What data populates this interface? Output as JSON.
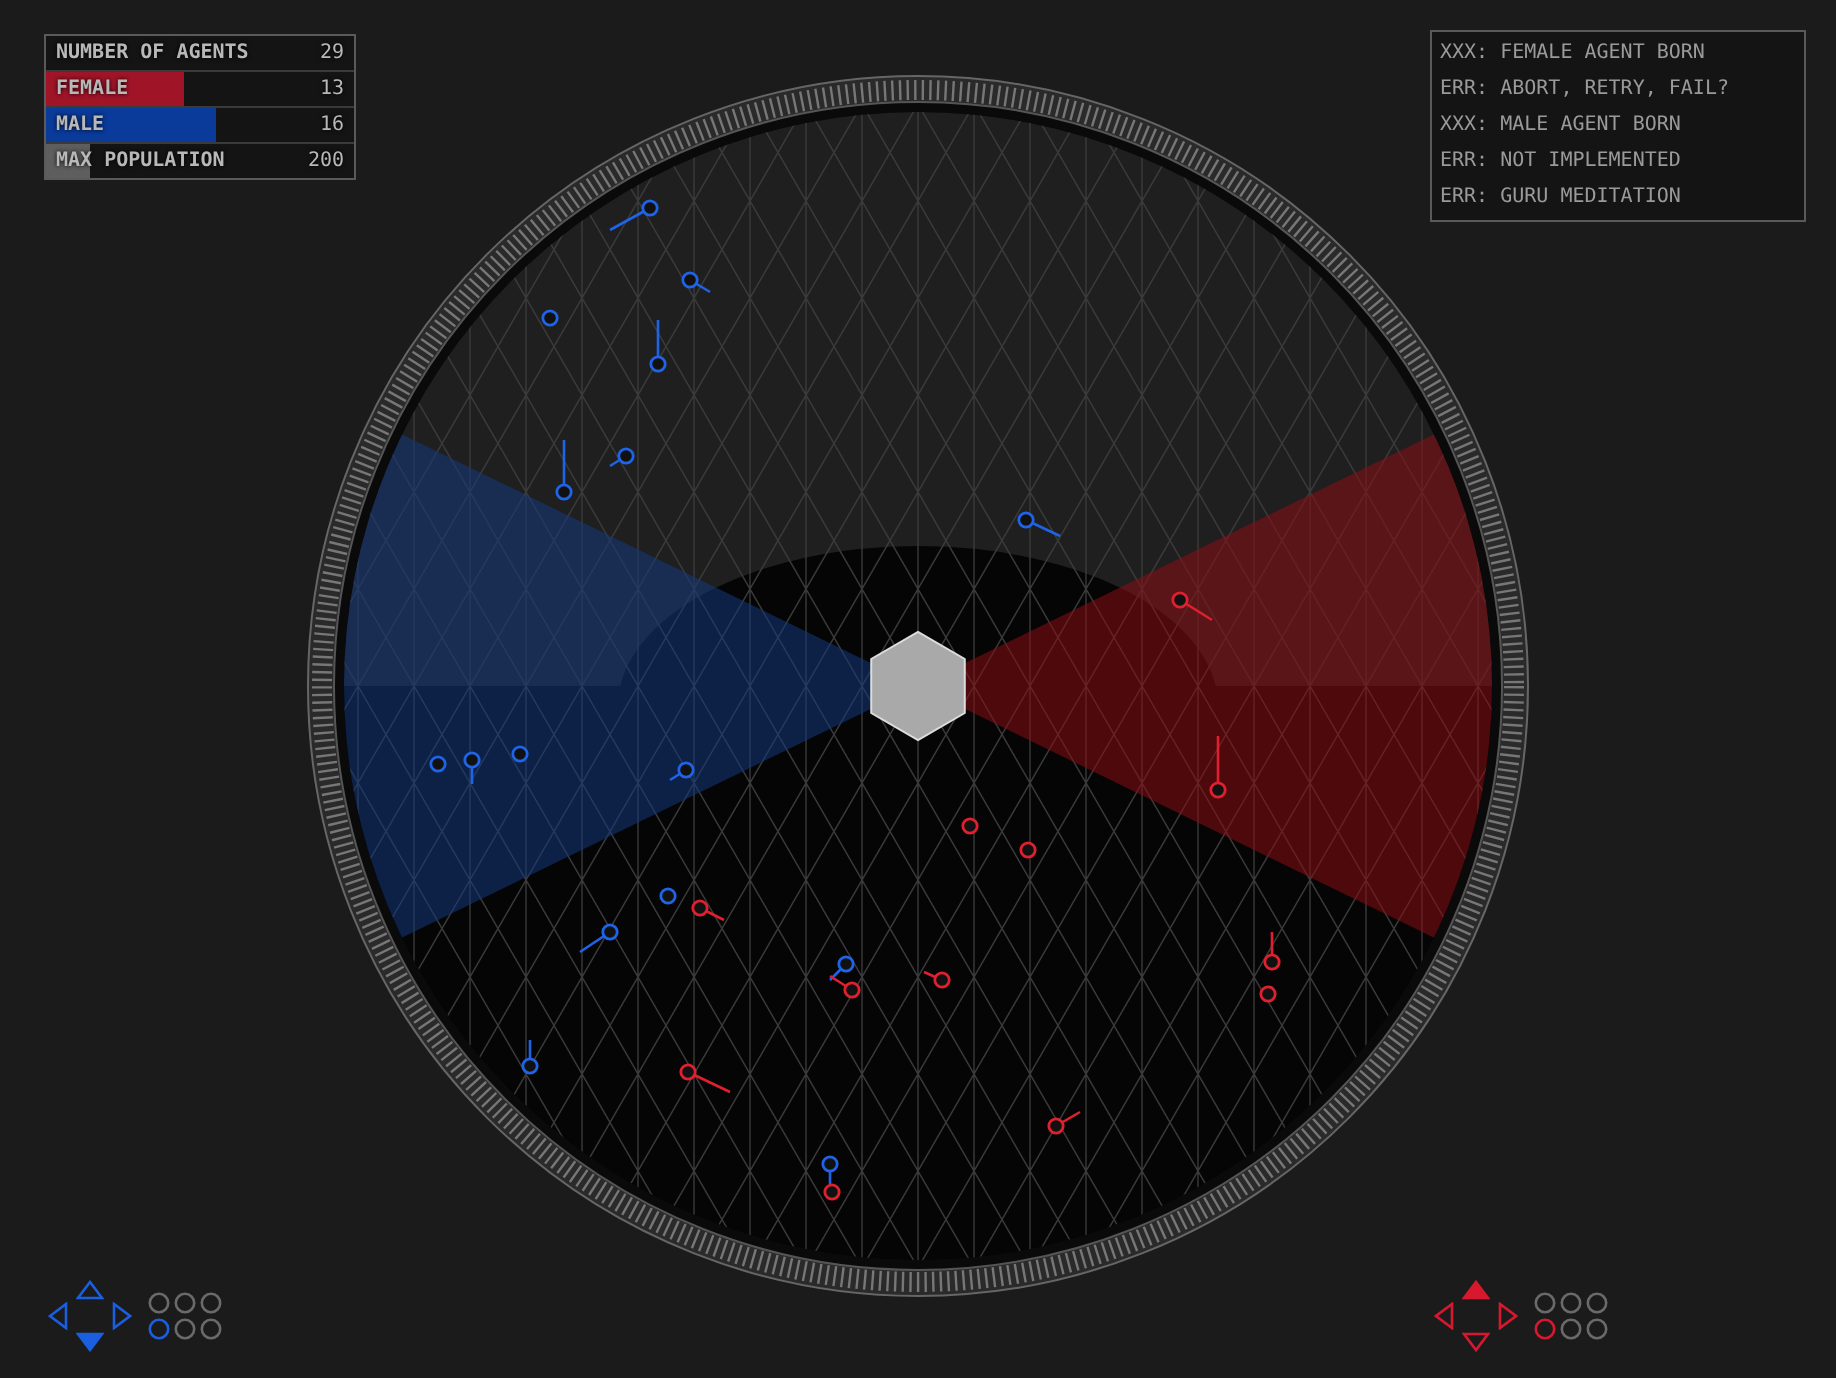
{
  "stats": [
    {
      "label": "NUMBER OF AGENTS",
      "value": "29"
    },
    {
      "label": "FEMALE",
      "value": "13",
      "level": 0.45,
      "color": "#a01428"
    },
    {
      "label": "MALE",
      "value": "16",
      "level": 0.55,
      "color": "#0a3a9a"
    },
    {
      "label": "MAX POPULATION",
      "value": "200",
      "level": 0.145,
      "color": "#5e5e5e"
    }
  ],
  "log": [
    "XXX: FEMALE AGENT BORN",
    "ERR: ABORT, RETRY, FAIL?",
    "XXX: MALE AGENT BORN",
    "ERR: NOT IMPLEMENTED",
    "ERR: GURU MEDITATION"
  ],
  "pads": [
    {
      "color": "#1a5fe0",
      "arrows": [
        {
          "filled": false
        },
        {
          "filled": false
        },
        {
          "filled": false
        },
        {
          "filled": true
        }
      ],
      "slots": [
        {
          "selected": false
        },
        {
          "selected": false
        },
        {
          "selected": false
        },
        {
          "selected": true
        },
        {
          "selected": false
        },
        {
          "selected": false
        }
      ]
    },
    {
      "color": "#d8182e",
      "arrows": [
        {
          "filled": true
        },
        {
          "filled": false
        },
        {
          "filled": false
        },
        {
          "filled": false
        }
      ],
      "slots": [
        {
          "selected": false
        },
        {
          "selected": false
        },
        {
          "selected": false
        },
        {
          "selected": true
        },
        {
          "selected": false
        },
        {
          "selected": false
        }
      ]
    }
  ]
}
